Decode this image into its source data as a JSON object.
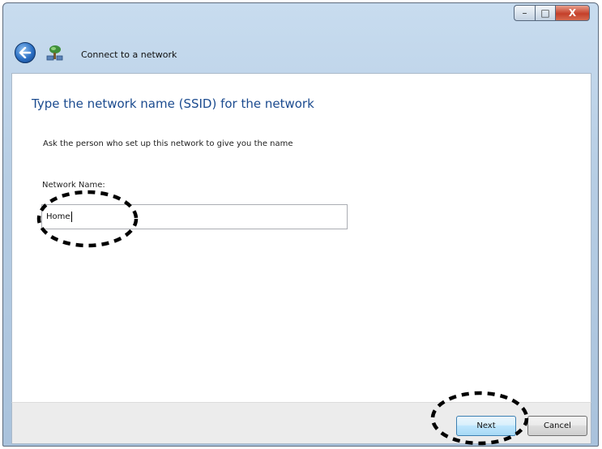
{
  "window": {
    "title": "Connect to a network",
    "controls": {
      "minimize": "–",
      "maximize": "□",
      "close": "X"
    }
  },
  "main": {
    "instruction": "Type the network name (SSID) for the network",
    "subtext": "Ask the person who set up this network to give you the name",
    "field_label": "Network Name:",
    "field_value": "Home"
  },
  "footer": {
    "next_label": "Next",
    "cancel_label": "Cancel"
  },
  "colors": {
    "instruction_blue": "#1b4b8f",
    "frame_blue": "#b6cde4"
  }
}
